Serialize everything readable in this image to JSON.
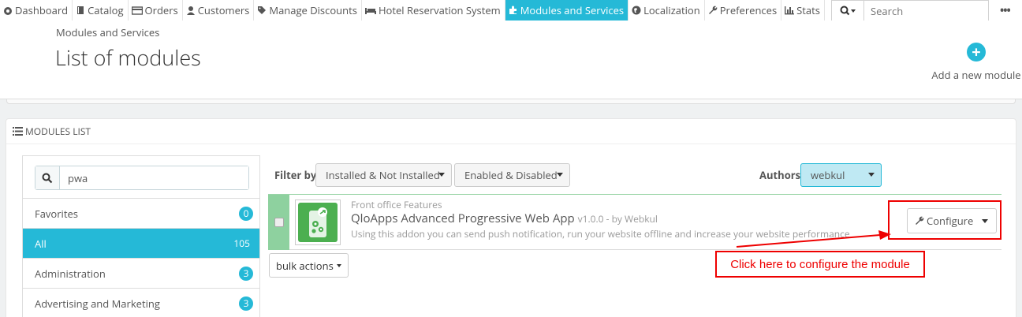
{
  "nav": {
    "items": [
      {
        "label": "Dashboard",
        "icon": "dashboard-icon"
      },
      {
        "label": "Catalog",
        "icon": "book-icon"
      },
      {
        "label": "Orders",
        "icon": "credit-card-icon"
      },
      {
        "label": "Customers",
        "icon": "user-icon"
      },
      {
        "label": "Manage Discounts",
        "icon": "tag-icon"
      },
      {
        "label": "Hotel Reservation System",
        "icon": "bed-icon"
      },
      {
        "label": "Modules and Services",
        "icon": "puzzle-icon",
        "active": true
      },
      {
        "label": "Localization",
        "icon": "globe-icon"
      },
      {
        "label": "Preferences",
        "icon": "wrench-icon"
      },
      {
        "label": "Stats",
        "icon": "bar-chart-icon"
      }
    ],
    "search_placeholder": "Search"
  },
  "header": {
    "breadcrumb": "Modules and Services",
    "title": "List of modules",
    "add_label": "Add a new module"
  },
  "panel": {
    "heading": "MODULES LIST"
  },
  "sidebar": {
    "search_value": "pwa",
    "categories": [
      {
        "label": "Favorites",
        "count": "0"
      },
      {
        "label": "All",
        "count": "105",
        "active": true
      },
      {
        "label": "Administration",
        "count": "3"
      },
      {
        "label": "Advertising and Marketing",
        "count": "3"
      }
    ]
  },
  "filters": {
    "label": "Filter by",
    "install_filter": "Installed & Not Installed",
    "enable_filter": "Enabled & Disabled",
    "authors_label": "Authors",
    "authors_value": "webkul"
  },
  "module": {
    "category": "Front office Features",
    "name": "QloApps Advanced Progressive Web App",
    "meta": "v1.0.0 - by Webkul",
    "description": "Using this addon you can send push notification, run your website offline and increase your website performance",
    "configure_label": "Configure"
  },
  "bulk_label": "bulk actions",
  "annotation": {
    "callout_text": "Click here to configure the module",
    "color": "#ee0000"
  },
  "colors": {
    "accent": "#25b9d7",
    "installed": "#8ed19f"
  }
}
